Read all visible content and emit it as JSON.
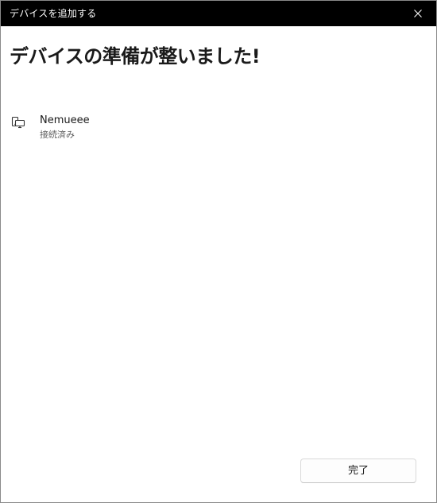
{
  "window": {
    "title": "デバイスを追加する"
  },
  "main": {
    "heading": "デバイスの準備が整いました!"
  },
  "device": {
    "name": "Nemueee",
    "status": "接続済み",
    "icon": "devices-icon"
  },
  "footer": {
    "done_label": "完了"
  },
  "colors": {
    "titlebar_bg": "#000000",
    "window_bg": "#ffffff",
    "text_primary": "#1a1a1a",
    "text_secondary": "#5f5f5f"
  }
}
